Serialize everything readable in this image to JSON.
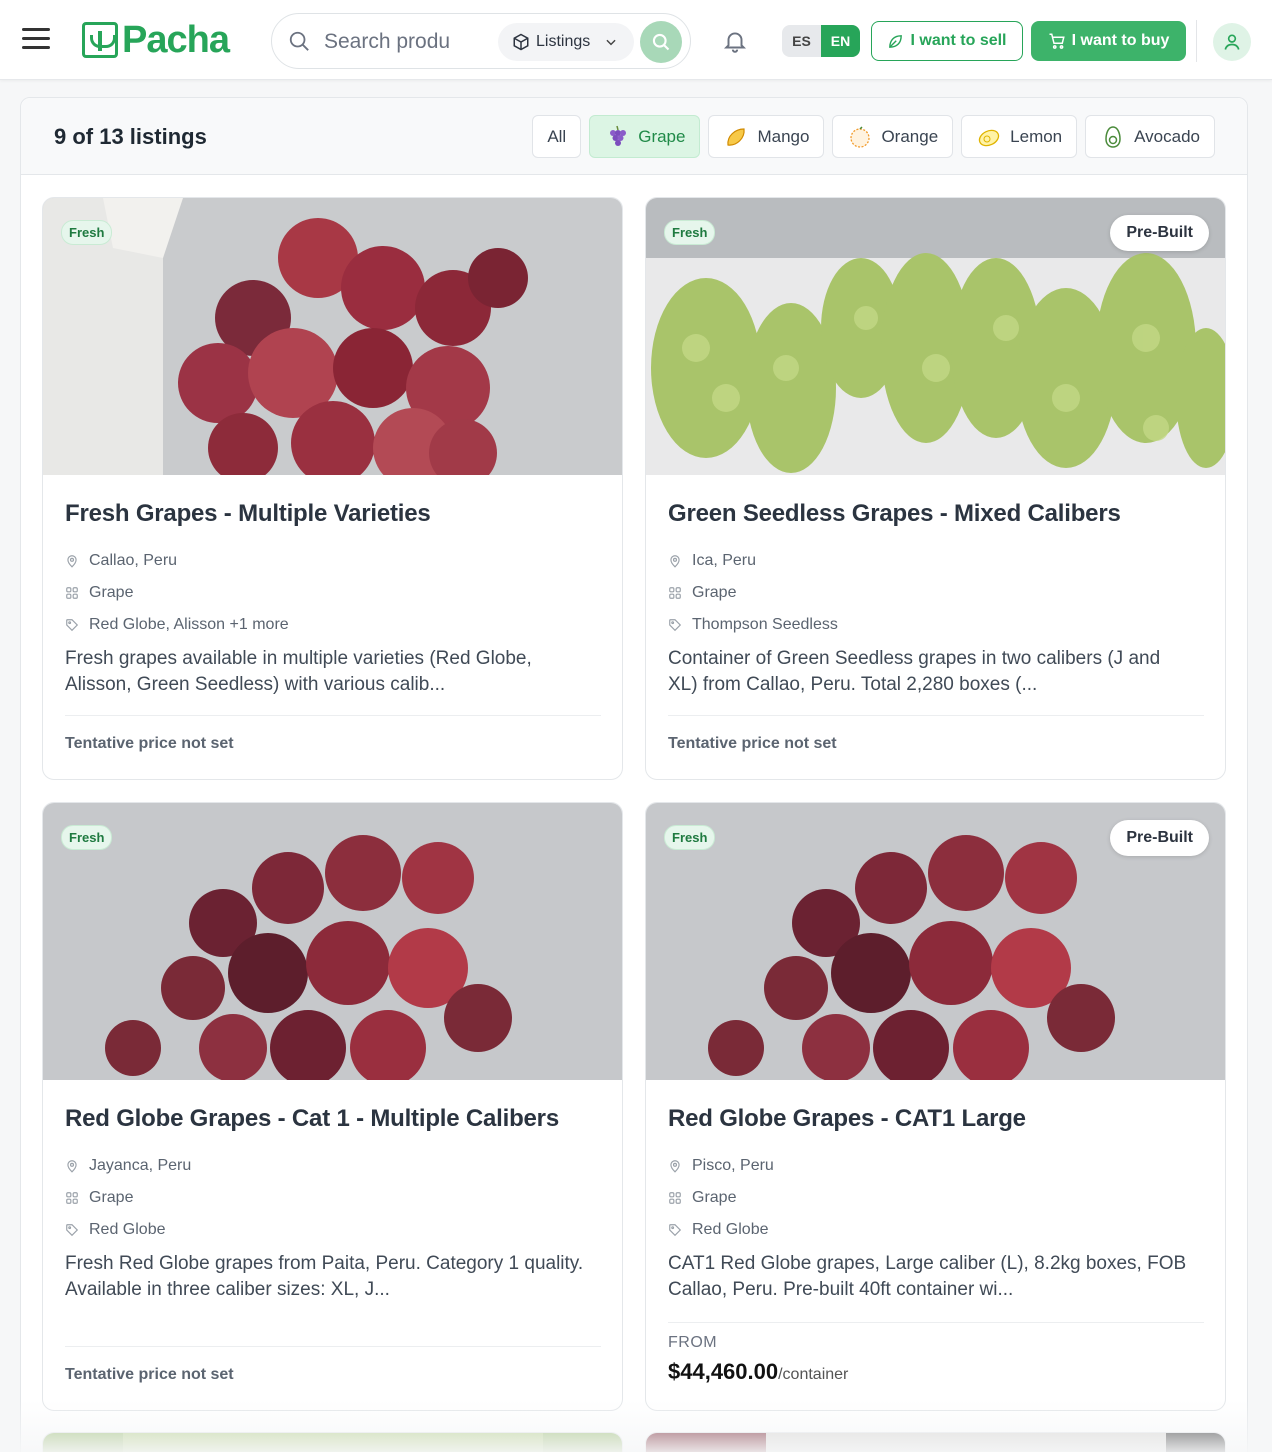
{
  "header": {
    "logo_text": "Pacha",
    "search_placeholder": "Search produ",
    "scope_label": "Listings",
    "lang_es": "ES",
    "lang_en": "EN",
    "sell_label": "I want to sell",
    "buy_label": "I want to buy",
    "accent": "#27a559"
  },
  "listing_count": "9 of 13 listings",
  "filters": [
    {
      "label": "All",
      "icon": "none",
      "active": false
    },
    {
      "label": "Grape",
      "icon": "grape-icon",
      "active": true
    },
    {
      "label": "Mango",
      "icon": "mango-icon",
      "active": false
    },
    {
      "label": "Orange",
      "icon": "orange-icon",
      "active": false
    },
    {
      "label": "Lemon",
      "icon": "lemon-icon",
      "active": false
    },
    {
      "label": "Avocado",
      "icon": "avocado-icon",
      "active": false
    }
  ],
  "cards": [
    {
      "badge": "Fresh",
      "prebuilt": "",
      "title": "Fresh Grapes - Multiple Varieties",
      "location": "Callao, Peru",
      "category": "Grape",
      "varieties": "Red Globe, Alisson +1 more",
      "description_1": "Fresh grapes available in multiple varieties (Red Globe,",
      "description_2": "Alisson, Green Seedless) with various calib...",
      "price_note": "Tentative price not set"
    },
    {
      "badge": "Fresh",
      "prebuilt": "Pre-Built",
      "title": "Green Seedless Grapes - Mixed Calibers",
      "location": "Ica, Peru",
      "category": "Grape",
      "varieties": "Thompson Seedless",
      "description_1": "Container of Green Seedless grapes in two calibers (J and",
      "description_2": "XL) from Callao, Peru. Total 2,280 boxes (...",
      "price_note": "Tentative price not set"
    },
    {
      "badge": "Fresh",
      "prebuilt": "",
      "title": "Red Globe Grapes - Cat 1 - Multiple Calibers",
      "location": "Jayanca, Peru",
      "category": "Grape",
      "varieties": "Red Globe",
      "description_1": "Fresh Red Globe grapes from Paita, Peru. Category 1 quality.",
      "description_2": "Available in three caliber sizes: XL, J...",
      "price_note": "Tentative price not set"
    },
    {
      "badge": "Fresh",
      "prebuilt": "Pre-Built",
      "title": "Red Globe Grapes - CAT1 Large",
      "location": "Pisco, Peru",
      "category": "Grape",
      "varieties": "Red Globe",
      "description_1": "CAT1 Red Globe grapes, Large caliber (L), 8.2kg boxes, FOB",
      "description_2": "Callao, Peru. Pre-built 40ft container wi...",
      "from_label": "FROM",
      "price": "$44,460.00",
      "price_unit": "/container"
    }
  ]
}
